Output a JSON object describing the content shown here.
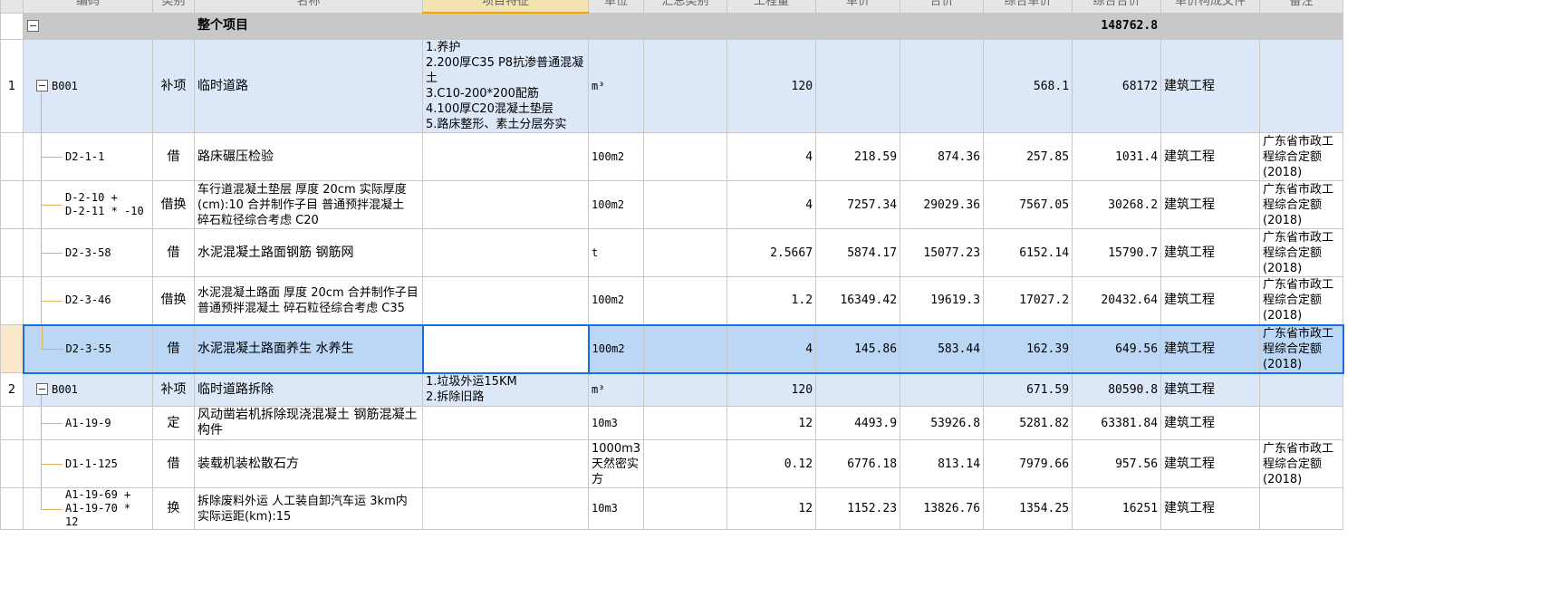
{
  "header": {
    "cols": [
      "编码",
      "类别",
      "名称",
      "项目特征",
      "单位",
      "汇总类别",
      "工程量",
      "单价",
      "合价",
      "综合单价",
      "综合合价",
      "单价构成文件",
      "备注"
    ]
  },
  "project": {
    "name": "整个项目",
    "total": "148762.8"
  },
  "rows": [
    {
      "rn": "1",
      "code": "B001",
      "type": "补项",
      "name": "临时道路",
      "features": "1.养护\n2.200厚C35 P8抗渗普通混凝土\n3.C10-200*200配筋\n4.100厚C20混凝土垫层\n5.路床整形、素土分层夯实",
      "unit": "m³",
      "qty": "120",
      "price": "",
      "amount": "",
      "cprice": "568.1",
      "camount": "68172",
      "file": "建筑工程",
      "note": ""
    },
    {
      "rn": "",
      "code": "D2-1-1",
      "type": "借",
      "name": "路床碾压检验",
      "features": "",
      "unit": "100m2",
      "qty": "4",
      "price": "218.59",
      "amount": "874.36",
      "cprice": "257.85",
      "camount": "1031.4",
      "file": "建筑工程",
      "note": "广东省市政工程综合定额(2018)"
    },
    {
      "rn": "",
      "code": "D-2-10 +\nD-2-11 * -10",
      "type": "借换",
      "name": "车行道混凝土垫层 厚度 20cm 实际厚度(cm):10 合并制作子目 普通预拌混凝土 碎石粒径综合考虑 C20",
      "features": "",
      "unit": "100m2",
      "qty": "4",
      "price": "7257.34",
      "amount": "29029.36",
      "cprice": "7567.05",
      "camount": "30268.2",
      "file": "建筑工程",
      "note": "广东省市政工程综合定额(2018)"
    },
    {
      "rn": "",
      "code": "D2-3-58",
      "type": "借",
      "name": "水泥混凝土路面钢筋 钢筋网",
      "features": "",
      "unit": "t",
      "qty": "2.5667",
      "price": "5874.17",
      "amount": "15077.23",
      "cprice": "6152.14",
      "camount": "15790.7",
      "file": "建筑工程",
      "note": "广东省市政工程综合定额(2018)"
    },
    {
      "rn": "",
      "code": "D2-3-46",
      "type": "借换",
      "name": "水泥混凝土路面 厚度 20cm 合并制作子目 普通预拌混凝土 碎石粒径综合考虑 C35",
      "features": "",
      "unit": "100m2",
      "qty": "1.2",
      "price": "16349.42",
      "amount": "19619.3",
      "cprice": "17027.2",
      "camount": "20432.64",
      "file": "建筑工程",
      "note": "广东省市政工程综合定额(2018)"
    },
    {
      "rn": "",
      "code": "D2-3-55",
      "type": "借",
      "name": "水泥混凝土路面养生 水养生",
      "features": "",
      "unit": "100m2",
      "qty": "4",
      "price": "145.86",
      "amount": "583.44",
      "cprice": "162.39",
      "camount": "649.56",
      "file": "建筑工程",
      "note": "广东省市政工程综合定额(2018)"
    },
    {
      "rn": "2",
      "code": "B001",
      "type": "补项",
      "name": "临时道路拆除",
      "features": "1.垃圾外运15KM\n2.拆除旧路",
      "unit": "m³",
      "qty": "120",
      "price": "",
      "amount": "",
      "cprice": "671.59",
      "camount": "80590.8",
      "file": "建筑工程",
      "note": ""
    },
    {
      "rn": "",
      "code": "A1-19-9",
      "type": "定",
      "name": "风动凿岩机拆除现浇混凝土 钢筋混凝土构件",
      "features": "",
      "unit": "10m3",
      "qty": "12",
      "price": "4493.9",
      "amount": "53926.8",
      "cprice": "5281.82",
      "camount": "63381.84",
      "file": "建筑工程",
      "note": ""
    },
    {
      "rn": "",
      "code": "D1-1-125",
      "type": "借",
      "name": "装载机装松散石方",
      "features": "",
      "unit": "1000m3天然密实方",
      "qty": "0.12",
      "price": "6776.18",
      "amount": "813.14",
      "cprice": "7979.66",
      "camount": "957.56",
      "file": "建筑工程",
      "note": "广东省市政工程综合定额(2018)"
    },
    {
      "rn": "",
      "code": "A1-19-69 +\nA1-19-70 * 12",
      "type": "换",
      "name": "拆除废料外运 人工装自卸汽车运 3km内 实际运距(km):15",
      "features": "",
      "unit": "10m3",
      "qty": "12",
      "price": "1152.23",
      "amount": "13826.76",
      "cprice": "1354.25",
      "camount": "16251",
      "file": "建筑工程",
      "note": ""
    }
  ],
  "icons": {
    "collapse": "collapse-minus-icon"
  },
  "colors": {
    "selection": "#1a6fe0",
    "section_bg": "#dce8f8",
    "selected_bg": "#bcd6f5",
    "project_bg": "#c8c8c8"
  }
}
